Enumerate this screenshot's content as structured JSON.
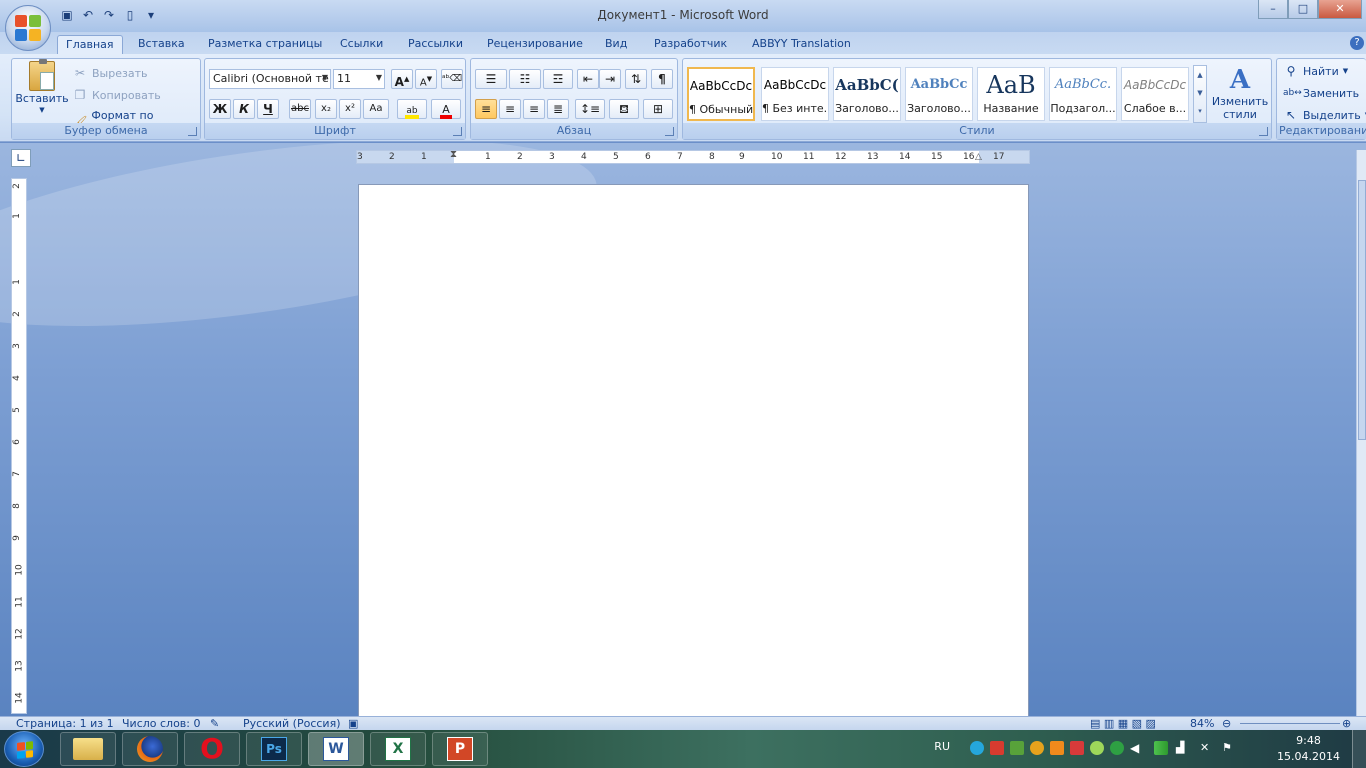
{
  "window": {
    "title": "Документ1 - Microsoft Word",
    "minimize": "–",
    "maximize": "□",
    "close": "✕"
  },
  "tabs": [
    {
      "label": "Главная"
    },
    {
      "label": "Вставка"
    },
    {
      "label": "Разметка страницы"
    },
    {
      "label": "Ссылки"
    },
    {
      "label": "Рассылки"
    },
    {
      "label": "Рецензирование"
    },
    {
      "label": "Вид"
    },
    {
      "label": "Разработчик"
    },
    {
      "label": "ABBYY Translation"
    }
  ],
  "clipboard": {
    "group_label": "Буфер обмена",
    "paste": "Вставить",
    "cut": "Вырезать",
    "copy": "Копировать",
    "format_painter": "Формат по образцу"
  },
  "font": {
    "group_label": "Шрифт",
    "font_name": "Calibri (Основной те",
    "font_size": "11",
    "bold": "Ж",
    "italic": "К",
    "underline": "Ч",
    "strike": "abc",
    "subscript": "x₂",
    "superscript": "x²",
    "change_case": "Aa",
    "grow": "A",
    "shrink": "A"
  },
  "paragraph": {
    "group_label": "Абзац",
    "pilcrow": "¶"
  },
  "styles": {
    "group_label": "Стили",
    "items": [
      {
        "sample": "AaBbCcDc",
        "name": "¶ Обычный"
      },
      {
        "sample": "AaBbCcDc",
        "name": "¶ Без инте..."
      },
      {
        "sample": "AaBbC(",
        "name": "Заголово..."
      },
      {
        "sample": "AaBbCc",
        "name": "Заголово..."
      },
      {
        "sample": "AaB",
        "name": "Название"
      },
      {
        "sample": "AaBbCc.",
        "name": "Подзагол..."
      },
      {
        "sample": "AaBbCcDc",
        "name": "Слабое в..."
      }
    ],
    "change_styles_line1": "Изменить",
    "change_styles_line2": "стили"
  },
  "editing": {
    "group_label": "Редактирование",
    "find": "Найти",
    "replace": "Заменить",
    "select": "Выделить"
  },
  "ruler": {
    "numbers": [
      "3",
      "2",
      "1",
      "1",
      "2",
      "3",
      "4",
      "5",
      "6",
      "7",
      "8",
      "9",
      "10",
      "11",
      "12",
      "13",
      "14",
      "15",
      "16",
      "17"
    ],
    "vnumbers": [
      "2",
      "1",
      "1",
      "2",
      "3",
      "4",
      "5",
      "6",
      "7",
      "8",
      "9",
      "10",
      "11",
      "12",
      "13",
      "14"
    ]
  },
  "status": {
    "page": "Страница: 1 из 1",
    "words": "Число слов: 0",
    "language": "Русский (Россия)",
    "zoom": "84%"
  },
  "taskbar": {
    "lang": "RU",
    "time": "9:48",
    "date": "15.04.2014",
    "apps": [
      {
        "name": "explorer",
        "label": ""
      },
      {
        "name": "firefox",
        "label": ""
      },
      {
        "name": "opera",
        "label": "O"
      },
      {
        "name": "photoshop",
        "label": "Ps"
      },
      {
        "name": "word",
        "label": "W"
      },
      {
        "name": "excel",
        "label": "X"
      },
      {
        "name": "powerpoint",
        "label": "P"
      }
    ]
  },
  "colors": {
    "accent": "#15428b",
    "ribbon_bg": "#dde9f9",
    "selected_style": "#f0b84f"
  }
}
